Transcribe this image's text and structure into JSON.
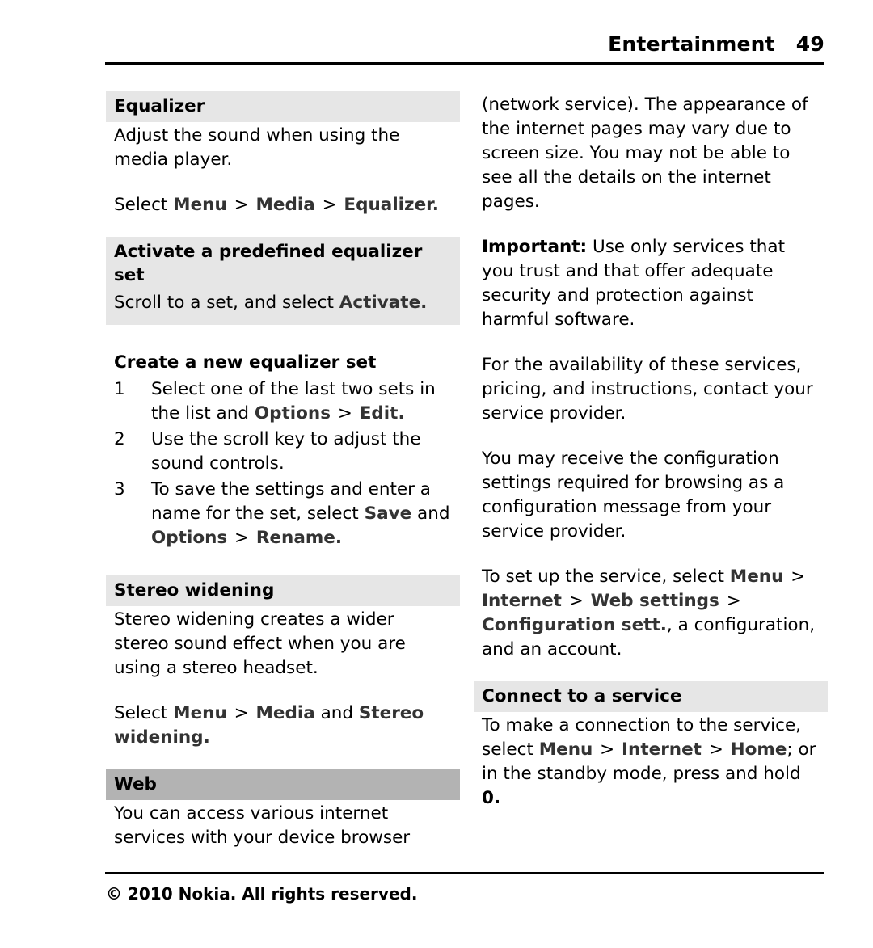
{
  "header": {
    "title": "Entertainment",
    "page_number": "49"
  },
  "footer": {
    "copyright_symbol": "©",
    "year": "2010",
    "text": "Nokia. All rights reserved."
  },
  "left_column": {
    "equalizer": {
      "heading": "Equalizer",
      "body": "Adjust the sound when using the media player.",
      "nav_prefix": "Select",
      "nav_1": "Menu",
      "sep_1": ">",
      "nav_2": "Media",
      "sep_2": ">",
      "nav_3": "Equalizer",
      "nav_suffix": "."
    },
    "activate_set": {
      "heading": "Activate a predefined equalizer set",
      "body_prefix": "Scroll to a set, and select",
      "body_bold": "Activate",
      "body_suffix": "."
    },
    "create_set": {
      "heading": "Create a new equalizer set",
      "steps": [
        {
          "number": "1",
          "text_prefix": "Select one of the last two sets in the list and",
          "bold_1": "Options",
          "sep": ">",
          "bold_2": "Edit",
          "text_suffix": "."
        },
        {
          "number": "2",
          "text_prefix": "Use the scroll key to adjust the sound controls.",
          "bold_1": "",
          "sep": "",
          "bold_2": "",
          "text_suffix": ""
        },
        {
          "number": "3",
          "text_prefix": "To save the settings and enter a name for the set, select",
          "bold_1": "Save",
          "mid": "and",
          "bold_2": "Options",
          "sep": ">",
          "bold_3": "Rename",
          "text_suffix": "."
        }
      ]
    },
    "stereo_widening": {
      "heading": "Stereo widening",
      "body": "Stereo widening creates a wider stereo sound effect when you are using a stereo headset.",
      "nav_prefix": "Select",
      "nav_1": "Menu",
      "sep_1": ">",
      "nav_2": "Media",
      "nav_mid": "and",
      "nav_3": "Stereo widening",
      "nav_suffix": "."
    },
    "web": {
      "heading": "Web",
      "body": "You can access various internet services with your device browser"
    }
  },
  "right_column": {
    "web_continued": {
      "body": "(network service). The appearance of the internet pages may vary due to screen size. You may not be able to see all the details on the internet pages."
    },
    "important": {
      "label": "Important:",
      "body": "Use only services that you trust and that offer adequate security and protection against harmful software."
    },
    "availability": {
      "body": "For the availability of these services, pricing, and instructions, contact your service provider."
    },
    "config_message": {
      "body": "You may receive the configuration settings required for browsing as a configuration message from your service provider."
    },
    "setup_service": {
      "text_prefix": "To set up the service, select",
      "bold_1": "Menu",
      "sep_1": ">",
      "bold_2": "Internet",
      "sep_2": ">",
      "bold_3": "Web settings",
      "sep_3": ">",
      "bold_4": "Configuration sett.",
      "text_suffix": ", a configuration, and an account."
    },
    "connect": {
      "heading": "Connect to a service",
      "text_prefix": "To make a connection to the service, select",
      "bold_1": "Menu",
      "sep_1": ">",
      "bold_2": "Internet",
      "sep_2": ">",
      "bold_3": "Home",
      "text_mid": "; or in the standby mode, press and hold",
      "bold_4": "0",
      "text_suffix": "."
    }
  }
}
